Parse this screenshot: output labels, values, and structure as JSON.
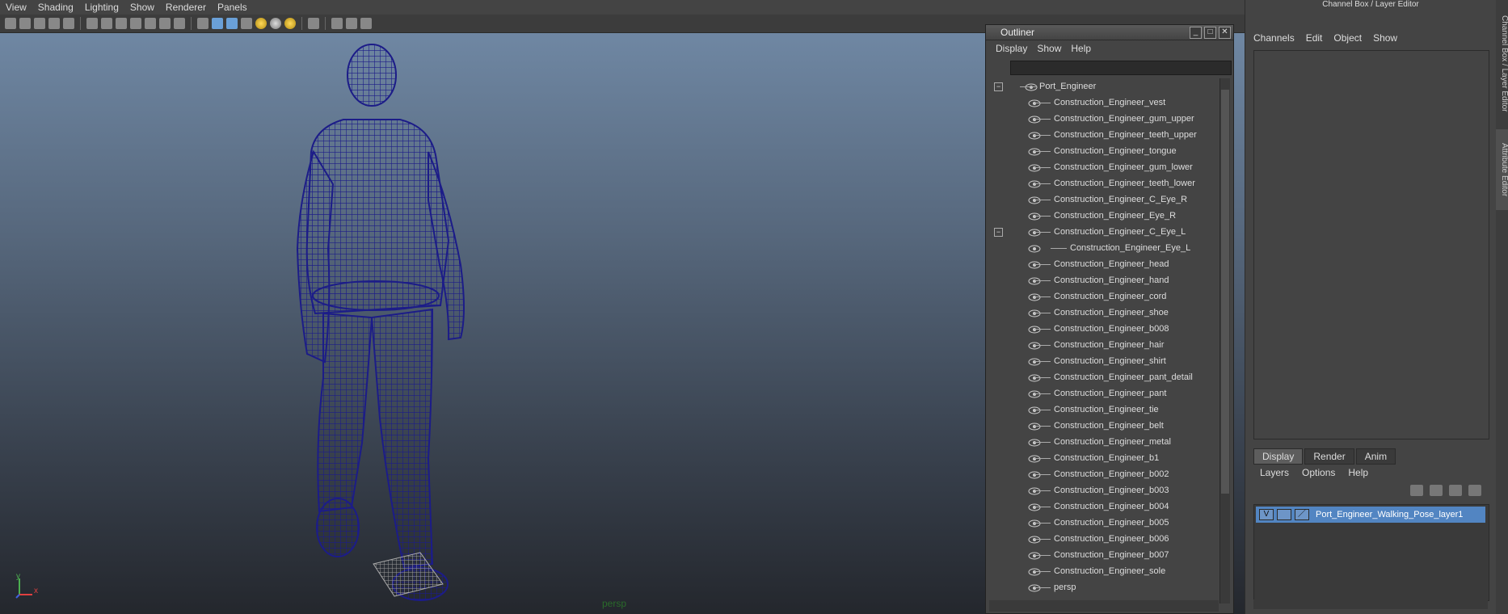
{
  "viewport": {
    "menu": [
      "View",
      "Shading",
      "Lighting",
      "Show",
      "Renderer",
      "Panels"
    ],
    "camera_label": "persp",
    "axis_y": "y",
    "axis_x": "x",
    "wire_color": "#1c1c88"
  },
  "outliner": {
    "title": "Outliner",
    "menu": [
      "Display",
      "Show",
      "Help"
    ],
    "root": "Port_Engineer",
    "items": [
      "Construction_Engineer_vest",
      "Construction_Engineer_gum_upper",
      "Construction_Engineer_teeth_upper",
      "Construction_Engineer_tongue",
      "Construction_Engineer_gum_lower",
      "Construction_Engineer_teeth_lower",
      "Construction_Engineer_C_Eye_R",
      "Construction_Engineer_Eye_R",
      "Construction_Engineer_C_Eye_L",
      "Construction_Engineer_Eye_L",
      "Construction_Engineer_head",
      "Construction_Engineer_hand",
      "Construction_Engineer_cord",
      "Construction_Engineer_shoe",
      "Construction_Engineer_b008",
      "Construction_Engineer_hair",
      "Construction_Engineer_shirt",
      "Construction_Engineer_pant_detail",
      "Construction_Engineer_pant",
      "Construction_Engineer_tie",
      "Construction_Engineer_belt",
      "Construction_Engineer_metal",
      "Construction_Engineer_b1",
      "Construction_Engineer_b002",
      "Construction_Engineer_b003",
      "Construction_Engineer_b004",
      "Construction_Engineer_b005",
      "Construction_Engineer_b006",
      "Construction_Engineer_b007",
      "Construction_Engineer_sole"
    ],
    "camera_item": "persp"
  },
  "rightpanel": {
    "title": "Channel Box / Layer Editor",
    "vtab_channel": "Channel Box / Layer Editor",
    "vtab_attr": "Attribute Editor",
    "menu": [
      "Channels",
      "Edit",
      "Object",
      "Show"
    ],
    "tabs": [
      "Display",
      "Render",
      "Anim"
    ],
    "layer_menu": [
      "Layers",
      "Options",
      "Help"
    ],
    "layer_visible": "V",
    "layer_name": "Port_Engineer_Walking_Pose_layer1",
    "accent": "#5285c2"
  }
}
